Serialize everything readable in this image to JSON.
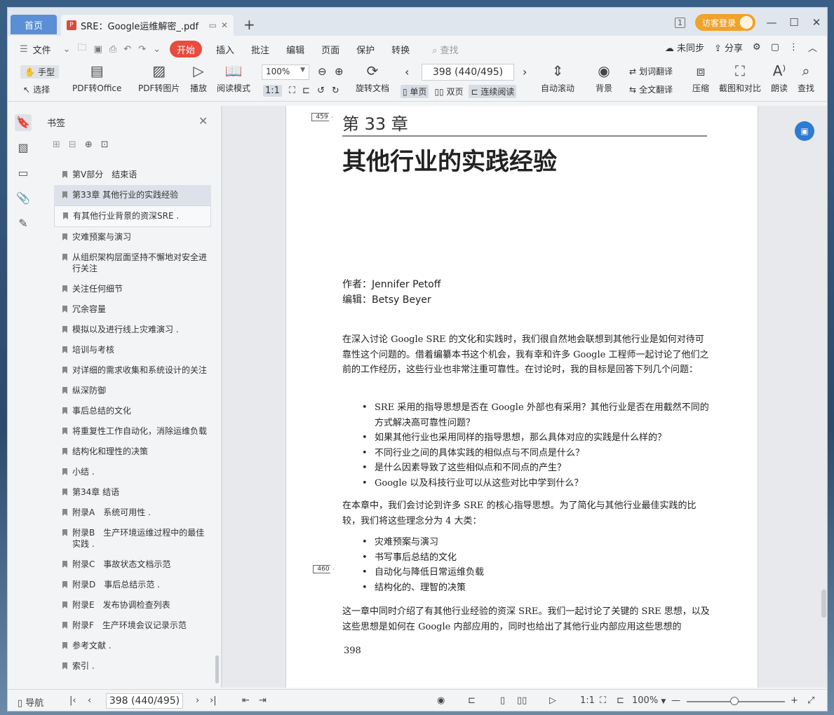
{
  "tabs": {
    "home": "首页",
    "document": "SRE：Google运维解密_.pdf",
    "new_tab": "+"
  },
  "title_right": {
    "page_count_badge": "1",
    "login": "访客登录",
    "minimize": "—",
    "maximize": "☐",
    "close": "✕"
  },
  "menu": {
    "file": "文件",
    "items": [
      "开始",
      "插入",
      "批注",
      "编辑",
      "页面",
      "保护",
      "转换"
    ],
    "search_placeholder": "查找",
    "sync": "未同步",
    "share": "分享"
  },
  "toolbar": {
    "hand": "手型",
    "select": "选择",
    "pdf_to_office": "PDF转Office",
    "pdf_to_image": "PDF转图片",
    "play": "播放",
    "read_mode": "阅读模式",
    "zoom": "100%",
    "rotate": "旋转文档",
    "page_display": "398 (440/495)",
    "single": "单页",
    "double": "双页",
    "continuous": "连续阅读",
    "auto_scroll": "自动滚动",
    "background": "背景",
    "word_translate": "划词翻译",
    "full_translate": "全文翻译",
    "compress": "压缩",
    "screenshot_compare": "截图和对比",
    "read_aloud": "朗读",
    "find": "查找"
  },
  "bookmarks": {
    "title": "书签",
    "items": [
      "第Ⅴ部分　结束语",
      "第33章 其他行业的实践经验",
      "有其他行业背景的资深SRE .",
      "灾难预案与演习",
      "从组织架构层面坚持不懈地对安全进行关注",
      "关注任何细节",
      "冗余容量",
      "模拟以及进行线上灾难演习 .",
      "培训与考核",
      "对详细的需求收集和系统设计的关注",
      "纵深防御",
      "事后总结的文化",
      "将重复性工作自动化，消除运维负载",
      "结构化和理性的决策",
      "小结 .",
      "第34章 结语",
      "附录A　系统可用性 .",
      "附录B　生产环境运维过程中的最佳实践 .",
      "附录C　事故状态文档示范",
      "附录D　事后总结示范 .",
      "附录E　发布协调检查列表",
      "附录F　生产环境会议记录示范",
      "参考文献 .",
      "索引 ."
    ]
  },
  "page": {
    "marker_top": "459",
    "marker_mid": "460",
    "chapter_no": "第 33 章",
    "chapter_title": "其他行业的实践经验",
    "author_line": "作者：Jennifer Petoff",
    "editor_line": "编辑：Betsy Beyer",
    "para1": "在深入讨论 Google SRE 的文化和实践时，我们很自然地会联想到其他行业是如何对待可靠性这个问题的。借着编纂本书这个机会，我有幸和许多 Google 工程师一起讨论了他们之前的工作经历，这些行业也非常注重可靠性。在讨论时，我的目标是回答下列几个问题：",
    "questions": [
      "SRE 采用的指导思想是否在 Google 外部也有采用？其他行业是否在用截然不同的方式解决高可靠性问题？",
      "如果其他行业也采用同样的指导思想，那么具体对应的实践是什么样的？",
      "不同行业之间的具体实践的相似点与不同点是什么？",
      "是什么因素导致了这些相似点和不同点的产生？",
      "Google 以及科技行业可以从这些对比中学到什么？"
    ],
    "para2": "在本章中，我们会讨论到许多 SRE 的核心指导思想。为了简化与其他行业最佳实践的比较，我们将这些理念分为 4 大类：",
    "categories": [
      "灾难预案与演习",
      "书写事后总结的文化",
      "自动化与降低日常运维负载",
      "结构化的、理智的决策"
    ],
    "para3": "这一章中同时介绍了有其他行业经验的资深 SRE。我们一起讨论了关键的 SRE 思想，以及这些思想是如何在 Google 内部应用的，同时也给出了其他行业内部应用这些思想的",
    "page_number": "398"
  },
  "statusbar": {
    "nav": "导航",
    "page_display": "398 (440/495)",
    "zoom": "100%"
  }
}
